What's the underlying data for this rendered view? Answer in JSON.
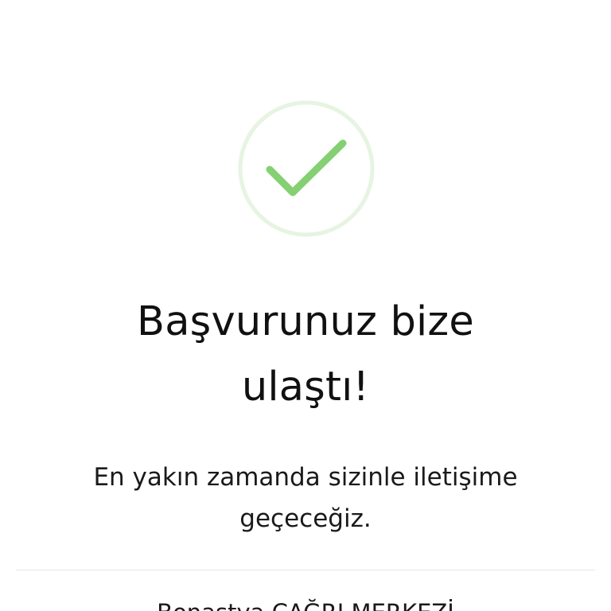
{
  "icons": {
    "success": "check-circle-icon"
  },
  "colors": {
    "check": "#84D072",
    "ring": "#E6F4E1",
    "divider": "#E6E6E6",
    "text": "#111111"
  },
  "success": {
    "title_line1": "Başvurunuz bize",
    "title_line2": "ulaştı!",
    "message_line1": "En yakın zamanda sizinle iletişime",
    "message_line2": "geçeceğiz."
  },
  "footer": {
    "call_center_text": "Bonastya ÇAĞRI MERKEZİ"
  }
}
